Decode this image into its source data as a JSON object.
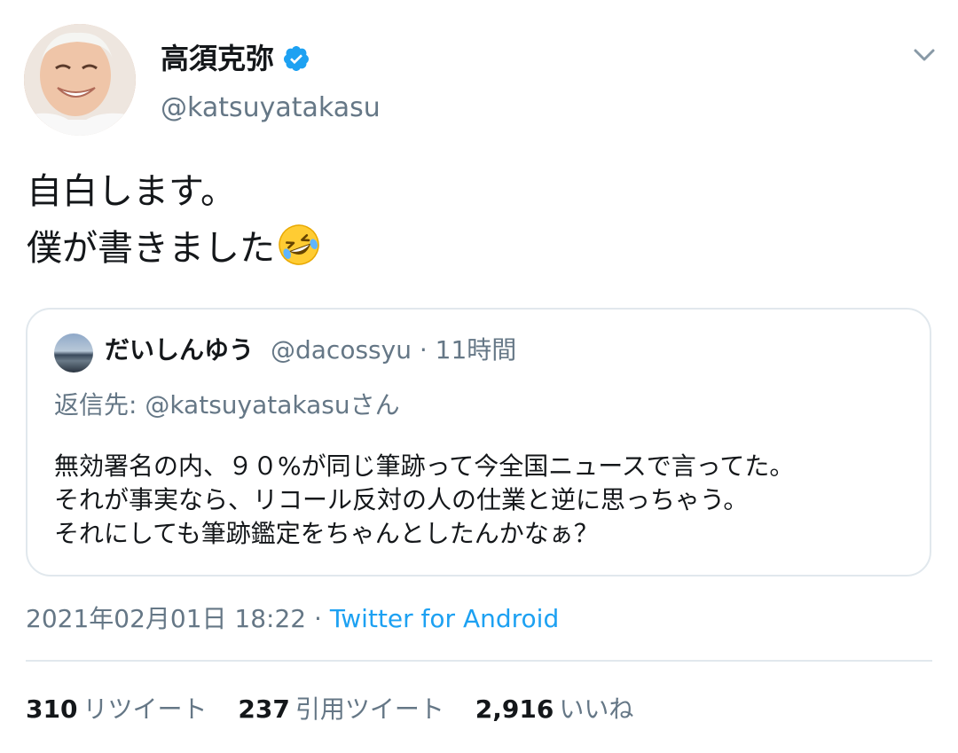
{
  "author": {
    "display_name": "高須克弥",
    "username": "@katsuyatakasu",
    "verified": true
  },
  "tweet": {
    "lines": [
      "自白します。",
      "僕が書きました"
    ],
    "emoji": "rolling-on-the-floor-laughing"
  },
  "quoted": {
    "display_name": "だいしんゆう",
    "meta": "@dacossyu · 11時間",
    "reply_to": "返信先: @katsuyatakasuさん",
    "lines": [
      "無効署名の内、９０%が同じ筆跡って今全国ニュースで言ってた。",
      "それが事実なら、リコール反対の人の仕業と逆に思っちゃう。",
      "それにしても筆跡鑑定をちゃんとしたんかなぁ？"
    ]
  },
  "timestamp": {
    "date": "2021年02月01日 18:22 · ",
    "source": "Twitter for Android"
  },
  "stats": {
    "retweets": {
      "count": "310",
      "label": "リツイート"
    },
    "quotes": {
      "count": "237",
      "label": "引用ツイート"
    },
    "likes": {
      "count": "2,916",
      "label": "いいね"
    }
  },
  "colors": {
    "text": "#14171a",
    "secondary": "#657786",
    "link": "#1da1f2",
    "border": "#e1e8ed",
    "verified": "#1da1f2"
  }
}
